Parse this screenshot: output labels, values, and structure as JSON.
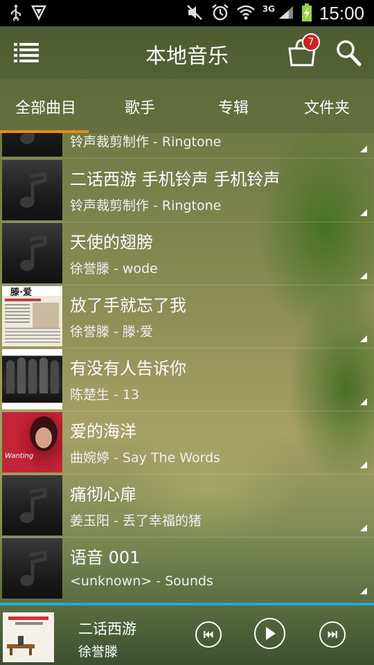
{
  "status_bar": {
    "time": "15:00",
    "network": "3G",
    "icons": [
      "usb-icon",
      "shield-icon",
      "mute-icon",
      "alarm-icon",
      "wifi-icon",
      "signal-icon",
      "battery-charging-icon"
    ]
  },
  "app_bar": {
    "title": "本地音乐",
    "cart_badge": "7"
  },
  "tabs": [
    {
      "label": "全部曲目",
      "selected": true
    },
    {
      "label": "歌手",
      "selected": false
    },
    {
      "label": "专辑",
      "selected": false
    },
    {
      "label": "文件夹",
      "selected": false
    }
  ],
  "songs": [
    {
      "title": "",
      "subtitle": "铃声裁剪制作 - Ringtone",
      "art": "default"
    },
    {
      "title": "二话西游 手机铃声 手机铃声",
      "subtitle": "铃声裁剪制作 - Ringtone",
      "art": "default"
    },
    {
      "title": "天使的翅膀",
      "subtitle": "徐誉滕 - wode",
      "art": "default"
    },
    {
      "title": "放了手就忘了我",
      "subtitle": "徐誉滕 - 滕·爱",
      "art": "newspaper"
    },
    {
      "title": "有没有人告诉你",
      "subtitle": "陈楚生 - 13",
      "art": "band"
    },
    {
      "title": "爱的海洋",
      "subtitle": "曲婉婷 - Say The Words",
      "art": "red-portrait"
    },
    {
      "title": "痛彻心扉",
      "subtitle": "姜玉阳 - 丢了幸福的猪",
      "art": "default"
    },
    {
      "title": "语音 001",
      "subtitle": "<unknown> - Sounds",
      "art": "default"
    }
  ],
  "art_text": {
    "newspaper_header": "滕·爱",
    "red_portrait_caption": "Wanting"
  },
  "now_playing": {
    "title": "二话西游",
    "artist": "徐誉滕"
  },
  "colors": {
    "tab_indicator": "#e98a1c",
    "progress_line": "#2ea7d2",
    "badge": "#d21f1f"
  }
}
